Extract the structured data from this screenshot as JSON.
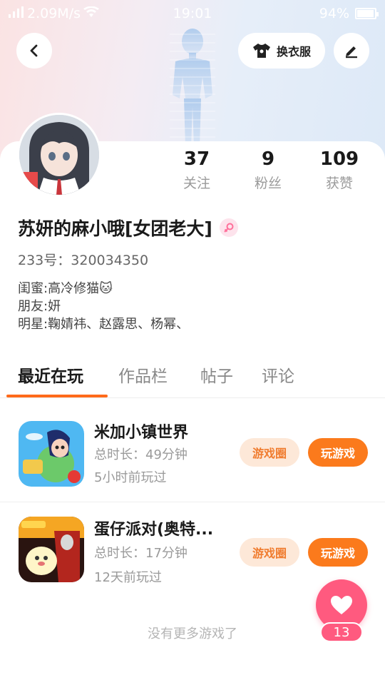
{
  "status_bar": {
    "network_speed": "2.09M/s",
    "time": "19:01",
    "battery_percent": "94%",
    "battery_level": 0.94
  },
  "header": {
    "outfit_button": "换衣服"
  },
  "profile": {
    "username": "苏妍的麻小哦[女团老大]",
    "uid_text": "233号：320034350",
    "bio_lines": [
      "闺蜜:高冷修猫🐱",
      "朋友:妍",
      "明星:鞠婧祎、赵露思、杨幂、"
    ],
    "stats": [
      {
        "value": "37",
        "label": "关注"
      },
      {
        "value": "9",
        "label": "粉丝"
      },
      {
        "value": "109",
        "label": "获赞"
      }
    ]
  },
  "tabs": [
    {
      "label": "最近在玩",
      "active": true
    },
    {
      "label": "作品栏",
      "active": false
    },
    {
      "label": "帖子",
      "active": false
    },
    {
      "label": "评论",
      "active": false
    }
  ],
  "games": [
    {
      "title": "米加小镇世界",
      "duration": "总时长：49分钟",
      "last_played": "5小时前玩过",
      "circle_label": "游戏圈",
      "play_label": "玩游戏"
    },
    {
      "title": "蛋仔派对(奥特...",
      "duration": "总时长：17分钟",
      "last_played": "12天前玩过",
      "circle_label": "游戏圈",
      "play_label": "玩游戏"
    }
  ],
  "footer_text": "没有更多游戏了",
  "like": {
    "count": "13"
  },
  "colors": {
    "accent": "#fb7a1c",
    "like": "#ff5a7f",
    "circle_bg": "#fde8d8"
  }
}
